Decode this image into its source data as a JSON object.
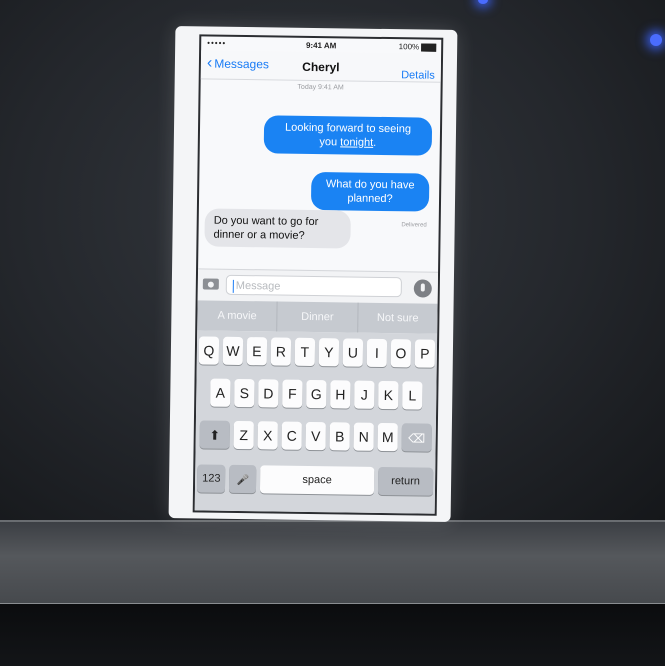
{
  "status_bar": {
    "carrier": "•••••",
    "time": "9:41 AM",
    "battery": "100%"
  },
  "nav": {
    "back_label": "Messages",
    "title": "Cheryl",
    "details_label": "Details"
  },
  "conversation": {
    "timestamp": "Today 9:41 AM",
    "messages": [
      {
        "direction": "outgoing",
        "text_a": "Looking forward to seeing",
        "text_b": "you ",
        "text_link": "tonight",
        "text_c": "."
      },
      {
        "direction": "outgoing",
        "text": "What do you have planned?"
      },
      {
        "direction": "incoming",
        "text": "Do you want to go for dinner or a movie?"
      }
    ],
    "delivered_label": "Delivered"
  },
  "input": {
    "placeholder": "Message"
  },
  "suggestions": [
    "A movie",
    "Dinner",
    "Not sure"
  ],
  "keyboard": {
    "row1": [
      "Q",
      "W",
      "E",
      "R",
      "T",
      "Y",
      "U",
      "I",
      "O",
      "P"
    ],
    "row2": [
      "A",
      "S",
      "D",
      "F",
      "G",
      "H",
      "J",
      "K",
      "L"
    ],
    "row3": [
      "Z",
      "X",
      "C",
      "V",
      "B",
      "N",
      "M"
    ],
    "numbers_label": "123",
    "space_label": "space",
    "return_label": "return",
    "shift_glyph": "⬆",
    "delete_glyph": "⌫",
    "mic_glyph": "🎤"
  },
  "icons": {
    "camera": "camera-icon",
    "mic": "mic-icon",
    "back": "chevron-left-icon"
  },
  "colors": {
    "accent": "#1a7cf5",
    "outgoing_bubble": "#1a83f3",
    "incoming_bubble": "#e4e5e9"
  }
}
